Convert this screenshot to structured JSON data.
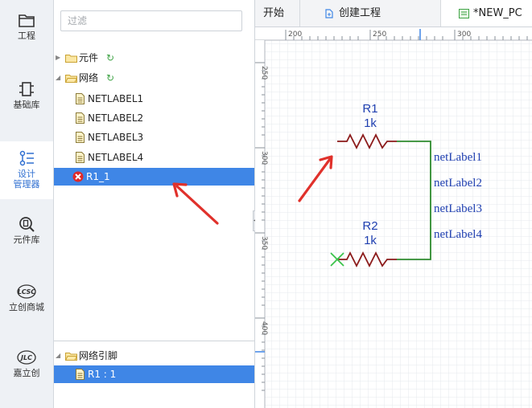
{
  "sidebar": {
    "items": [
      {
        "label": "工程",
        "icon": "folder-icon"
      },
      {
        "label": "基础库",
        "icon": "component-icon"
      },
      {
        "label": "设计\n管理器",
        "icon": "design-manager-icon",
        "active": true
      },
      {
        "label": "元件库",
        "icon": "library-search-icon"
      },
      {
        "label": "立创商城",
        "icon": "lcsc-logo-icon",
        "logo_text": "LCSC"
      },
      {
        "label": "嘉立创",
        "icon": "jlc-logo-icon",
        "logo_text": "JLC"
      }
    ]
  },
  "tree": {
    "filter_placeholder": "过滤",
    "components_label": "元件",
    "nets_label": "网络",
    "netlabels": [
      "NETLABEL1",
      "NETLABEL2",
      "NETLABEL3",
      "NETLABEL4"
    ],
    "selected_net": "R1_1",
    "pins_folder": "网络引脚",
    "pin_item": "R1 : 1"
  },
  "tabs": [
    {
      "label": "开始"
    },
    {
      "label": "创建工程",
      "icon": "project-icon"
    },
    {
      "label": "*NEW_PC",
      "icon": "schematic-icon"
    }
  ],
  "ruler": {
    "top_labels": [
      "200",
      "250",
      "300"
    ],
    "left_labels": [
      "250",
      "300",
      "350",
      "400"
    ]
  },
  "schematic": {
    "r1_ref": "R1",
    "r1_value": "1k",
    "r2_ref": "R2",
    "r2_value": "1k",
    "net_labels": [
      "netLabel1",
      "netLabel2",
      "netLabel3",
      "netLabel4"
    ]
  },
  "colors": {
    "accent": "#3f86e6",
    "resistor": "#8b1a1a",
    "wire": "#2e8b2e",
    "netlabel": "#1f3fb0",
    "arrow": "#e0312b",
    "error": "#e02828"
  }
}
